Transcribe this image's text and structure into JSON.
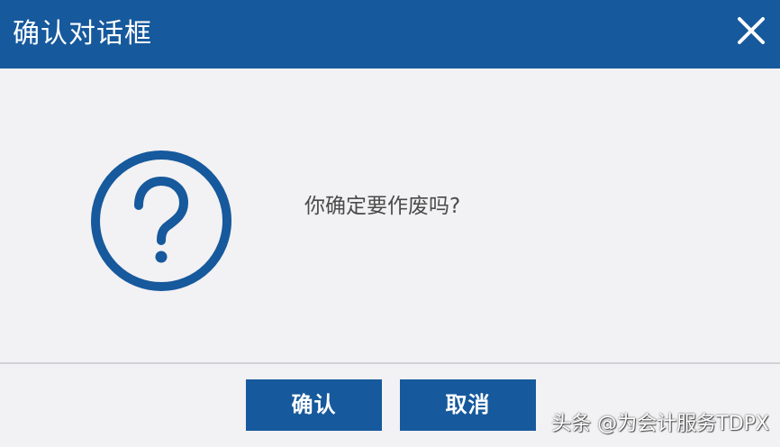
{
  "dialog": {
    "title": "确认对话框",
    "close_icon": "close-icon",
    "message": "你确定要作废吗?",
    "icon": "question-circle-icon",
    "buttons": {
      "confirm_label": "确认",
      "cancel_label": "取消"
    }
  },
  "watermark": {
    "text": "头条 @为会计服务TDPX"
  },
  "colors": {
    "titlebar": "#16599c",
    "button": "#16599c",
    "background": "#f2f1f3",
    "message_text": "#4a4a4a",
    "icon": "#16599c"
  }
}
